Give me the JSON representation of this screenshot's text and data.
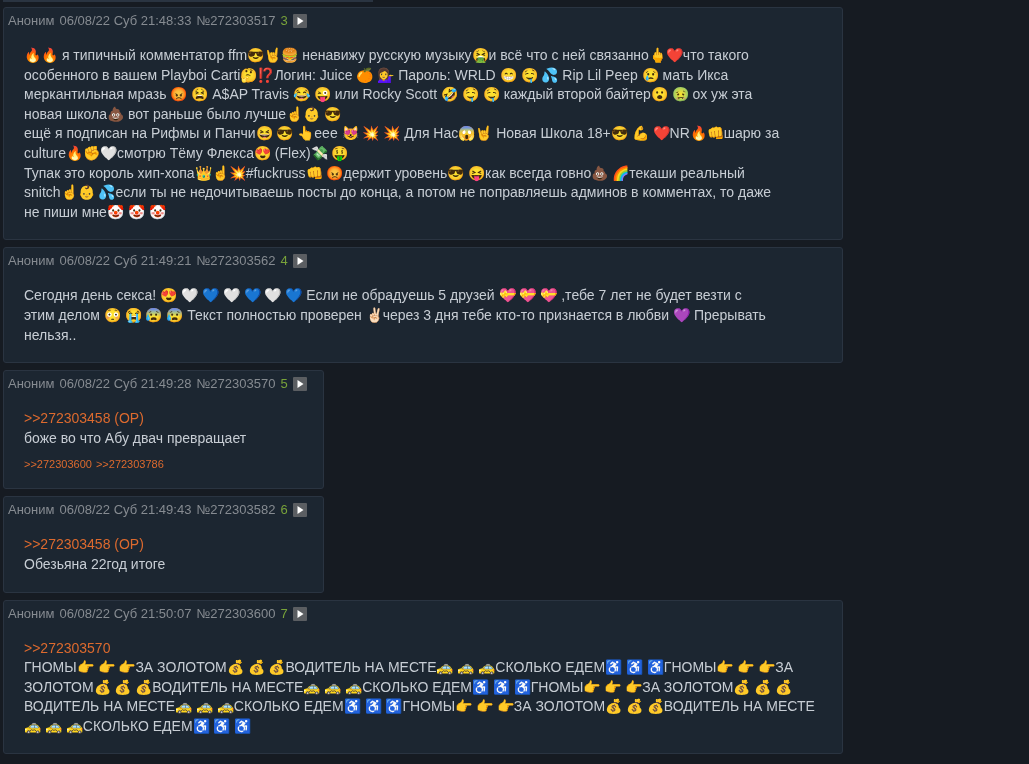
{
  "posts": [
    {
      "author": "Аноним",
      "date": "06/08/22 Суб 21:48:33",
      "number": "№272303517",
      "index": "3",
      "lines": [
        "🔥🔥 я типичный комментатор ffm😎🤘🍔 ненавижу русскую музыку🤮и всё что с ней связанно🖕❤️что такого",
        "особенного в вашем Playboi Carti🤔⁉️Логин: Juice 🍊 💁‍♀️ Пароль: WRLD 😁 🤤 💦 Rip Lil Peep 😢 мать Икса",
        "меркантильная мразь 😡 😫 A$AP Travis 😂 😜 или Rocky Scott 🤣 🤤 🤤 каждый второй байтер😮 🤢 ох уж эта",
        "новая школа💩 вот раньше было лучше☝️👶 😎",
        "ещё я подписан на Рифмы и Панчи😆 😎 👆eee 😻 💥 💥 Для Нас😱🤘 Новая Школа 18+😎 💪 ❤️NR🔥👊шарю за",
        "culture🔥✊🤍смотрю Тёму Флекса😍 (Flex)💸 🤑",
        "Тупак это король хип-хопа👑☝️💥#fuckruss👊 😡держит уровень😎 😝как всегда говно💩 🌈текаши реальный",
        "snitch☝️👶 💦если ты не недочитываешь посты до конца, а потом не поправляешь админов в комментах, то даже",
        "не пиши мне🤡 🤡 🤡"
      ]
    },
    {
      "author": "Аноним",
      "date": "06/08/22 Суб 21:49:21",
      "number": "№272303562",
      "index": "4",
      "lines": [
        "Сегодня день секса! 😍 🤍  💙 🤍 💙 🤍  💙 Если не обрадуешь 5 друзей 💝 💝 💝 ,тебе 7 лет не будет везти с",
        "этим делом 😳  😭 😰 😰 Текст полностью проверен ✌🏻через 3 дня тебе кто-то признается в любви 💜 Прерывать",
        "нельзя.."
      ]
    },
    {
      "author": "Аноним",
      "date": "06/08/22 Суб 21:49:28",
      "number": "№272303570",
      "index": "5",
      "reply_to": ">>272303458 (OP)",
      "lines": [
        "боже во что Абу двач превращает"
      ],
      "replies": [
        ">>272303600",
        ">>272303786"
      ]
    },
    {
      "author": "Аноним",
      "date": "06/08/22 Суб 21:49:43",
      "number": "№272303582",
      "index": "6",
      "reply_to": ">>272303458 (OP)",
      "lines": [
        "Обезьяна 22год итоге"
      ]
    },
    {
      "author": "Аноним",
      "date": "06/08/22 Суб 21:50:07",
      "number": "№272303600",
      "index": "7",
      "reply_to": ">>272303570",
      "lines": [
        "ГНОМЫ👉 👉 👉ЗА ЗОЛОТОМ💰 💰 💰ВОДИТЕЛЬ НА МЕСТЕ🚕 🚕 🚕СКОЛЬКО ЕДЕМ♿ ♿ ♿ГНОМЫ👉 👉 👉ЗА",
        "ЗОЛОТОМ💰 💰 💰ВОДИТЕЛЬ НА МЕСТЕ🚕 🚕 🚕СКОЛЬКО ЕДЕМ♿ ♿ ♿ГНОМЫ👉 👉 👉ЗА ЗОЛОТОМ💰 💰 💰",
        "ВОДИТЕЛЬ НА МЕСТЕ🚕 🚕 🚕СКОЛЬКО ЕДЕМ♿ ♿ ♿ГНОМЫ👉 👉 👉ЗА ЗОЛОТОМ💰 💰 💰ВОДИТЕЛЬ НА МЕСТЕ",
        "🚕 🚕 🚕СКОЛЬКО ЕДЕМ♿ ♿ ♿"
      ]
    }
  ]
}
